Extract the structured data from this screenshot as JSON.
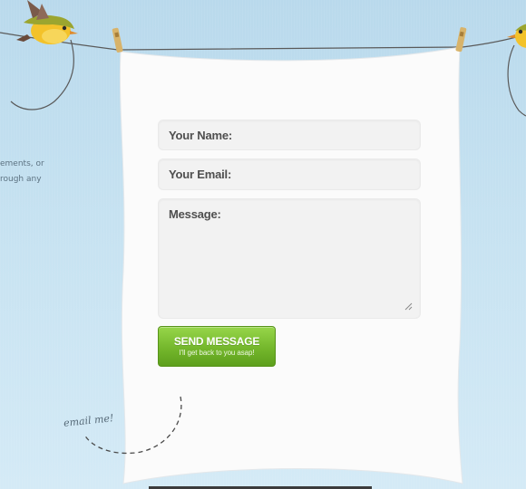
{
  "side_text": {
    "line1": "ements, or",
    "line2": "rough any"
  },
  "form": {
    "name_label": "Your Name:",
    "email_label": "Your Email:",
    "message_label": "Message:",
    "send_label": "SEND MESSAGE",
    "send_sublabel": "I'll get back to you asap!"
  },
  "note": {
    "email_me": "email me!"
  },
  "colors": {
    "background": "#c6e2f1",
    "paper": "#fbfbfb",
    "field": "#f2f2f2",
    "button": "#74b72c"
  }
}
